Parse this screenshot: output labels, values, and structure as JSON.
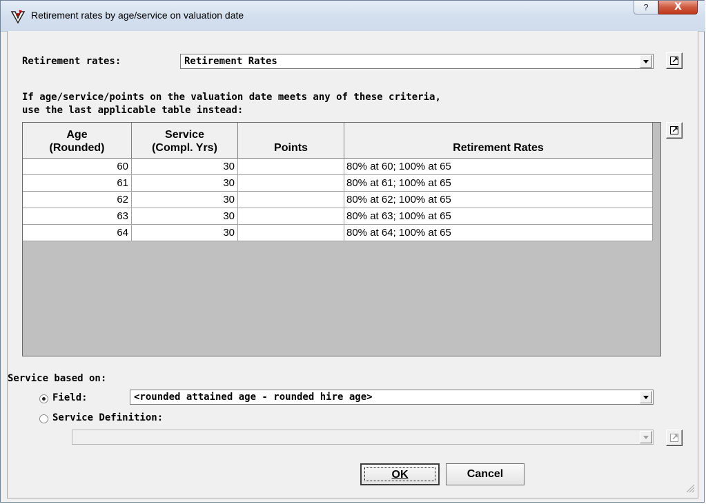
{
  "window": {
    "title": "Retirement rates by age/service on valuation date",
    "help_label": "?",
    "close_label": "X"
  },
  "retirement_rates": {
    "label": "Retirement rates:",
    "value": "Retirement Rates"
  },
  "criteria_text": {
    "line1": "If age/service/points on the valuation date meets any of these criteria,",
    "line2": "use the last applicable table instead:"
  },
  "table": {
    "columns": [
      "Age\n(Rounded)",
      "Service\n(Compl. Yrs)",
      "Points",
      "Retirement Rates"
    ],
    "rows": [
      {
        "age": "60",
        "service": "30",
        "points": "",
        "rates": "80% at 60; 100% at 65"
      },
      {
        "age": "61",
        "service": "30",
        "points": "",
        "rates": "80% at 61; 100% at 65"
      },
      {
        "age": "62",
        "service": "30",
        "points": "",
        "rates": "80% at 62; 100% at 65"
      },
      {
        "age": "63",
        "service": "30",
        "points": "",
        "rates": "80% at 63; 100% at 65"
      },
      {
        "age": "64",
        "service": "30",
        "points": "",
        "rates": "80% at 64; 100% at 65"
      }
    ]
  },
  "service_based_on": {
    "label": "Service based on:",
    "field_option": {
      "label": "Field:",
      "selected": true,
      "value": "<rounded attained age - rounded hire age>"
    },
    "definition_option": {
      "label": "Service Definition:",
      "selected": false,
      "value": ""
    }
  },
  "buttons": {
    "ok": "OK",
    "cancel": "Cancel"
  },
  "icons": {
    "app": "app-logo-icon",
    "jump": "jump-arrow-icon",
    "dropdown": "chevron-down-icon",
    "resize": "resize-grip-icon"
  }
}
